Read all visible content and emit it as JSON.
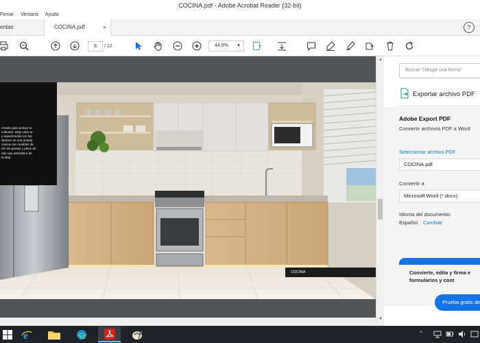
{
  "window": {
    "title": "COCINA.pdf - Adobe Acrobat Reader (32-bit)"
  },
  "menu": {
    "items": [
      "Firmar",
      "Ventana",
      "Ayuda"
    ]
  },
  "tabs": {
    "tools_label": "entas",
    "doc_label": "COCINA.pdf",
    "close_glyph": "×",
    "help_glyph": "?"
  },
  "toolbar": {
    "page_current": "8",
    "page_total": "/ 12",
    "zoom": "44.9%",
    "icons": [
      "print-icon",
      "zoom-search-icon",
      "prev-page-icon",
      "next-page-icon",
      "select-pointer-icon",
      "hand-icon",
      "zoom-out-icon",
      "zoom-in-icon",
      "fit-page-icon",
      "scroll-mode-icon",
      "comment-icon",
      "highlight-icon",
      "sign-icon",
      "share-icon",
      "delete-icon",
      "rotate-icon"
    ]
  },
  "document": {
    "overlay_text_lines": [
      "creado para activar tu",
      "culinaria. Deje volar tu",
      "y experimenta con los",
      " deseen en una amplia",
      "cocina con muebles de",
      "ero de granito y pisos de",
      "ndo una atmósfera de",
      "ticidad."
    ],
    "caption": "COCINA"
  },
  "right_panel": {
    "search_placeholder": "Buscar 'Dibujar una forma'",
    "export_label": "Exportar archivo PDF",
    "heading": "Adobe Export PDF",
    "subtitle": "Convertir archivos PDF a Word",
    "select_file_link": "Seleccionar archivo PDF",
    "file_name": "COCINA.pdf",
    "convert_label": "Convertir a",
    "format_value": "Microsoft Word (*.docx)",
    "language_label": "Idioma del documento:",
    "language_value": "Español",
    "change_link": "Cambiar",
    "promo_line1": "Convierte, edita y firma e",
    "promo_line2": "formularios y cont",
    "trial_button": "Prueba gratis de"
  },
  "taskbar": {
    "apps": [
      "windows-start-icon",
      "ie-icon",
      "file-explorer-icon",
      "edge-icon",
      "acrobat-icon",
      "paint-icon"
    ],
    "active_app": "acrobat-icon"
  },
  "colors": {
    "accent": "#1473e6",
    "doc_background": "#525659",
    "taskbar": "#1e2226"
  }
}
